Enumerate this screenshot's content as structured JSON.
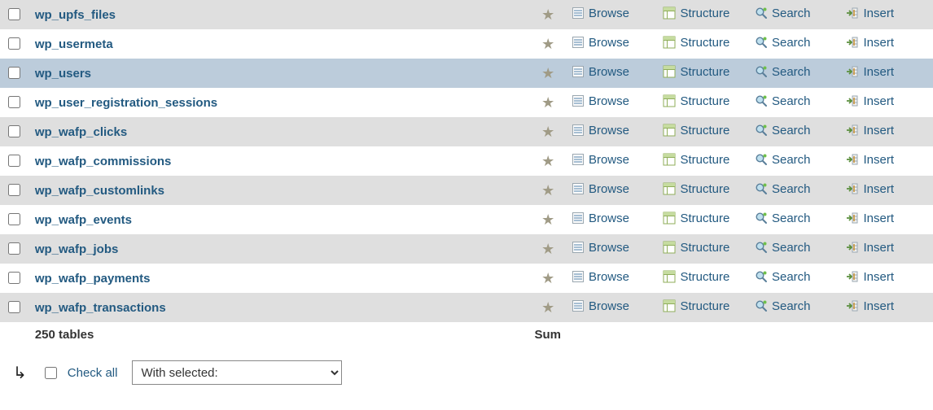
{
  "actions": {
    "browse": "Browse",
    "structure": "Structure",
    "search": "Search",
    "insert": "Insert"
  },
  "tables": [
    {
      "name": "wp_upfs_files",
      "parity": "even",
      "highlight": false
    },
    {
      "name": "wp_usermeta",
      "parity": "odd",
      "highlight": false
    },
    {
      "name": "wp_users",
      "parity": "even",
      "highlight": true
    },
    {
      "name": "wp_user_registration_sessions",
      "parity": "odd",
      "highlight": false
    },
    {
      "name": "wp_wafp_clicks",
      "parity": "even",
      "highlight": false
    },
    {
      "name": "wp_wafp_commissions",
      "parity": "odd",
      "highlight": false
    },
    {
      "name": "wp_wafp_customlinks",
      "parity": "even",
      "highlight": false
    },
    {
      "name": "wp_wafp_events",
      "parity": "odd",
      "highlight": false
    },
    {
      "name": "wp_wafp_jobs",
      "parity": "even",
      "highlight": false
    },
    {
      "name": "wp_wafp_payments",
      "parity": "odd",
      "highlight": false
    },
    {
      "name": "wp_wafp_transactions",
      "parity": "even",
      "highlight": false
    }
  ],
  "summary": {
    "tables_label": "250 tables",
    "sum_label": "Sum"
  },
  "footer": {
    "check_all_label": "Check all",
    "with_selected_label": "With selected:"
  }
}
